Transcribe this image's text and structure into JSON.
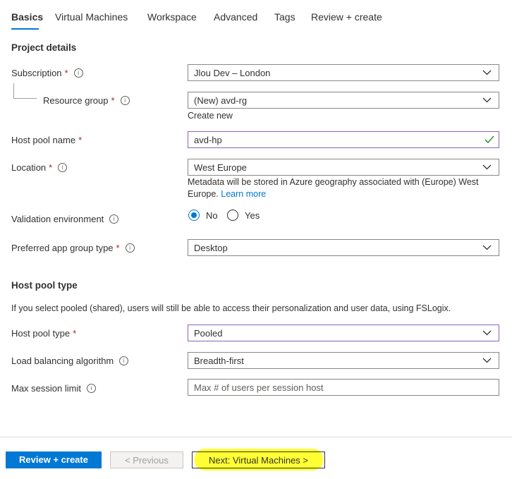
{
  "tabs": [
    {
      "label": "Basics",
      "active": true
    },
    {
      "label": "Virtual Machines"
    },
    {
      "label": "Workspace"
    },
    {
      "label": "Advanced"
    },
    {
      "label": "Tags"
    },
    {
      "label": "Review + create"
    }
  ],
  "project": {
    "title": "Project details",
    "subscription": {
      "label": "Subscription",
      "value": "Jlou Dev – London"
    },
    "resource_group": {
      "label": "Resource group",
      "value": "(New) avd-rg",
      "create_new": "Create new"
    }
  },
  "host_pool_name": {
    "label": "Host pool name",
    "value": "avd-hp"
  },
  "location": {
    "label": "Location",
    "value": "West Europe",
    "help": "Metadata will be stored in Azure geography associated with (Europe) West Europe.",
    "learn_more": "Learn more"
  },
  "validation": {
    "label": "Validation environment",
    "options": [
      "No",
      "Yes"
    ],
    "selected": "No"
  },
  "app_group": {
    "label": "Preferred app group type",
    "value": "Desktop"
  },
  "host_pool_type_section": {
    "title": "Host pool type",
    "description": "If you select pooled (shared), users will still be able to access their personalization and user data, using FSLogix."
  },
  "host_pool_type": {
    "label": "Host pool type",
    "value": "Pooled"
  },
  "load_balancing": {
    "label": "Load balancing algorithm",
    "value": "Breadth-first"
  },
  "max_session": {
    "label": "Max session limit",
    "placeholder": "Max # of users per session host"
  },
  "required_marker": "*",
  "info_glyph": "i",
  "footer": {
    "review_create": "Review + create",
    "previous": "< Previous",
    "next": "Next: Virtual Machines >"
  },
  "colors": {
    "accent": "#0078d4",
    "required": "#a4262c",
    "focus_border": "#8764b8",
    "highlight": "#ffff33",
    "valid": "#107c10"
  }
}
